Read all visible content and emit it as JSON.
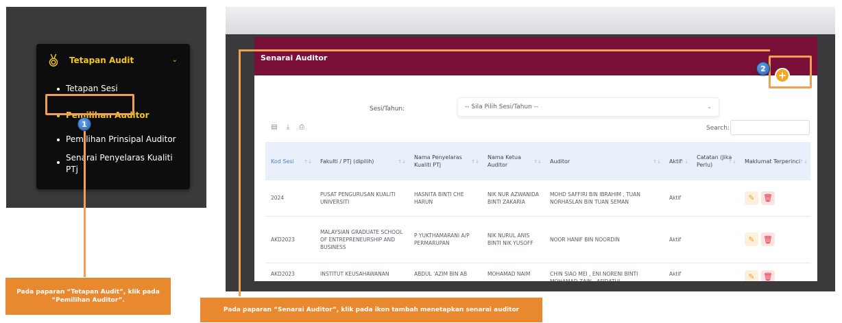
{
  "sidebar": {
    "menu_title": "Tetapan Audit",
    "items": [
      {
        "label": "Tetapan Sesi"
      },
      {
        "label": "Pemilihan Auditor"
      },
      {
        "label": "Pemilihan Prinsipal Auditor"
      },
      {
        "label": "Senarai Penyelaras Kualiti PTj"
      }
    ]
  },
  "main": {
    "card_title": "Senarai Auditor",
    "filter_label": "Sesi/Tahun:",
    "filter_value": "-- Sila Pilih Sesi/Tahun --",
    "search_label": "Search:",
    "columns": [
      "Kod Sesi",
      "Fakulti / PTj (dipilih)",
      "Nama Penyelaras Kualiti PTj",
      "Nama Ketua Auditor",
      "Auditor",
      "Aktif",
      "Catatan (Jika Perlu)",
      "Maklumat Terperinci"
    ],
    "rows": [
      {
        "kod": "2024",
        "fakulti": "PUSAT PENGURUSAN KUALITI UNIVERSITI",
        "penyelaras": "HASNITA BINTI CHE HARUN",
        "ketua": "NIK NUR AZWANIDA BINTI ZAKARIA",
        "auditor": "MOHD SAFFIRI BIN IBRAHIM , TUAN NORHASLAN BIN TUAN SEMAN",
        "aktif": "Aktif",
        "catatan": ""
      },
      {
        "kod": "AKD2023",
        "fakulti": "MALAYSIAN GRADUATE SCHOOL OF ENTREPRENEURSHIP AND BUSINESS",
        "penyelaras": "P YUKTHAMARANI A/P PERMARUPAN",
        "ketua": "NIK NURUL ANIS BINTI NIK YUSOFF",
        "auditor": "NOOR HANIF BIN NOORDIN",
        "aktif": "Aktif",
        "catatan": ""
      },
      {
        "kod": "AKD2023",
        "fakulti": "INSTITUT KEUSAHAWANAN",
        "penyelaras": "ABDUL 'AZIM BIN AB",
        "ketua": "MOHAMAD NAIM",
        "auditor": "CHIN SIAO MEI , ENI NORENI BINTI MOHAMAD ZAIN , AFIDATUL",
        "aktif": "Aktif",
        "catatan": ""
      }
    ]
  },
  "annotations": {
    "badge1": "1",
    "badge2": "2",
    "callout1": "Pada paparan “Tetapan Audit”,  klik pada “Pemilihan Auditor”.",
    "callout2": "Pada paparan “Senarai Auditor”, klik pada ikon tambah menetapkan senarai auditor"
  },
  "colors": {
    "accent_yellow": "#f5c518",
    "header_maroon": "#7a0f3a",
    "annotation_orange": "#e8892f"
  }
}
